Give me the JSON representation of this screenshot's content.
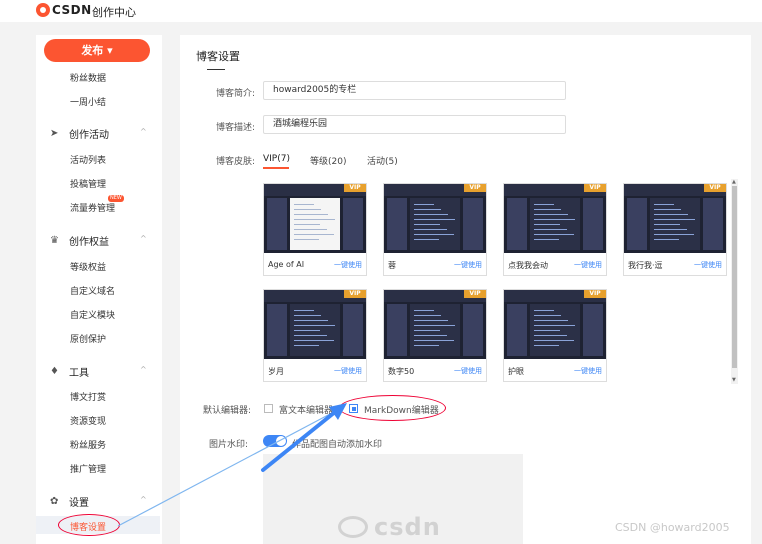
{
  "topbar": {
    "logo_text": "CSDN",
    "title": "创作中心"
  },
  "sidebar": {
    "publish_label": "发布",
    "publish_caret": "▾",
    "items_top": [
      "粉丝数据",
      "一周小结"
    ],
    "groups": [
      {
        "label": "创作活动",
        "icon": "paper-plane-icon",
        "items": [
          "活动列表",
          "投稿管理",
          "流量券管理"
        ]
      },
      {
        "label": "创作权益",
        "icon": "crown-icon",
        "items": [
          "等级权益",
          "自定义域名",
          "自定义模块",
          "原创保护"
        ]
      },
      {
        "label": "工具",
        "icon": "tool-icon",
        "items": [
          "博文打赏",
          "资源变现",
          "粉丝服务",
          "推广管理"
        ]
      },
      {
        "label": "设置",
        "icon": "gear-icon",
        "items": [
          "博客设置"
        ]
      }
    ],
    "new_badge": "NEW",
    "chevron": "^"
  },
  "main": {
    "title": "博客设置",
    "intro_label": "博客简介:",
    "intro_value": "howard2005的专栏",
    "desc_label": "博客描述:",
    "desc_value": "酒城编程乐园",
    "skin_label": "博客皮肤:",
    "tabs": [
      "VIP(7)",
      "等级(20)",
      "活动(5)"
    ],
    "skins": [
      {
        "name": "Age of AI",
        "use": "一键使用",
        "vip": "VIP",
        "light": true
      },
      {
        "name": "蓉",
        "use": "一键使用",
        "vip": "VIP",
        "light": false
      },
      {
        "name": "点我我会动",
        "use": "一键使用",
        "vip": "VIP",
        "light": false
      },
      {
        "name": "我行我·逗",
        "use": "一键使用",
        "vip": "VIP",
        "light": false
      },
      {
        "name": "岁月",
        "use": "一键使用",
        "vip": "VIP",
        "light": false
      },
      {
        "name": "数字50",
        "use": "一键使用",
        "vip": "VIP",
        "light": false
      },
      {
        "name": "护眼",
        "use": "一键使用",
        "vip": "VIP",
        "light": false
      }
    ],
    "editor_label": "默认编辑器:",
    "editor_options": [
      "富文本编辑器",
      "MarkDown编辑器"
    ],
    "editor_selected": "MarkDown编辑器",
    "watermark_label": "图片水印:",
    "watermark_toggle_label": "作品配图自动添加水印",
    "watermark_enabled": true,
    "watermark_preview_logo": "csdn"
  },
  "bottom_watermark": "CSDN @howard2005",
  "colors": {
    "brand": "#fc5531",
    "link": "#3d86f5",
    "annotation": "#e00033",
    "vip_tag": "#e8a12e"
  }
}
